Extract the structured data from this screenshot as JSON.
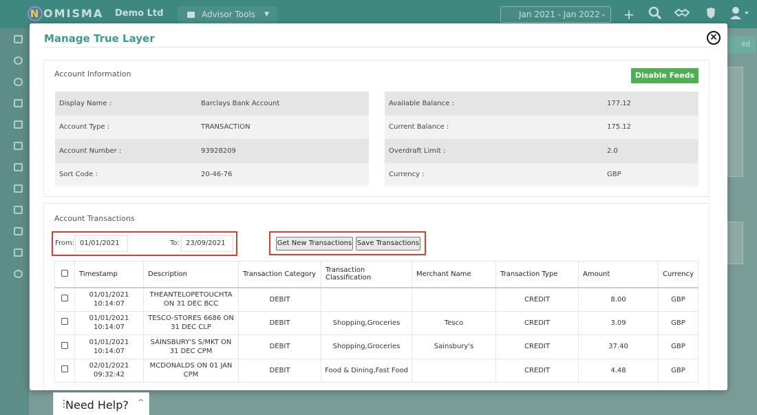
{
  "app": {
    "logo": "NOMISMA",
    "company": "Demo Ltd",
    "advisor_tools": "Advisor Tools",
    "date_range": "Jan 2021 - Jan 2022",
    "bg_button": "ed"
  },
  "icons": {
    "topbar": [
      "plus-icon",
      "search-icon",
      "handshake-icon",
      "crest-icon",
      "user-icon"
    ],
    "sidebar": [
      "dashboard-icon",
      "coin-icon",
      "money-bag-icon",
      "bank-icon",
      "grid-icon",
      "tag-icon",
      "briefcase-icon",
      "clipboard-icon",
      "document-icon",
      "calculator-icon",
      "report-icon",
      "gear-icon"
    ]
  },
  "modal": {
    "title": "Manage True Layer",
    "close": "×"
  },
  "account_info": {
    "title": "Account Information",
    "disable_button": "Disable Feeds",
    "left": [
      {
        "label": "Display Name :",
        "value": "Barclays Bank Account"
      },
      {
        "label": "Account Type :",
        "value": "TRANSACTION"
      },
      {
        "label": "Account Number :",
        "value": "93928209"
      },
      {
        "label": "Sort Code :",
        "value": "20-46-76"
      }
    ],
    "right": [
      {
        "label": "Available Balance :",
        "value": "177.12"
      },
      {
        "label": "Current Balance :",
        "value": "175.12"
      },
      {
        "label": "Overdraft Limit :",
        "value": "2.0"
      },
      {
        "label": "Currency :",
        "value": "GBP"
      }
    ]
  },
  "transactions": {
    "title": "Account Transactions",
    "from_label": "From:",
    "from_value": "01/01/2021",
    "to_label": "To:",
    "to_value": "23/09/2021",
    "get_button": "Get New Transactions",
    "save_button": "Save Transactions",
    "columns": [
      "Timestamp",
      "Description",
      "Transaction Category",
      "Transaction Classification",
      "Merchant Name",
      "Transaction Type",
      "Amount",
      "Currency"
    ],
    "rows": [
      {
        "ts1": "01/01/2021",
        "ts2": "10:14:07",
        "desc1": "THEANTELOPETOUCHTA",
        "desc2": "ON 31 DEC BCC",
        "category": "DEBIT",
        "classification": "",
        "merchant": "",
        "type": "CREDIT",
        "amount": "8.00",
        "currency": "GBP"
      },
      {
        "ts1": "01/01/2021",
        "ts2": "10:14:07",
        "desc1": "TESCO-STORES 6686 ON",
        "desc2": "31 DEC CLP",
        "category": "DEBIT",
        "classification": "Shopping,Groceries",
        "merchant": "Tesco",
        "type": "CREDIT",
        "amount": "3.09",
        "currency": "GBP"
      },
      {
        "ts1": "01/01/2021",
        "ts2": "10:14:07",
        "desc1": "SAINSBURY'S S/MKT ON",
        "desc2": "31 DEC CPM",
        "category": "DEBIT",
        "classification": "Shopping,Groceries",
        "merchant": "Sainsbury's",
        "type": "CREDIT",
        "amount": "37.40",
        "currency": "GBP"
      },
      {
        "ts1": "02/01/2021",
        "ts2": "09:32:42",
        "desc1": "MCDONALDS ON 01 JAN",
        "desc2": "CPM",
        "category": "DEBIT",
        "classification": "Food & Dining,Fast Food",
        "merchant": "",
        "type": "CREDIT",
        "amount": "4.48",
        "currency": "GBP"
      }
    ]
  },
  "help": {
    "dots": "⋮",
    "label": "Need Help?",
    "caret": "^"
  }
}
